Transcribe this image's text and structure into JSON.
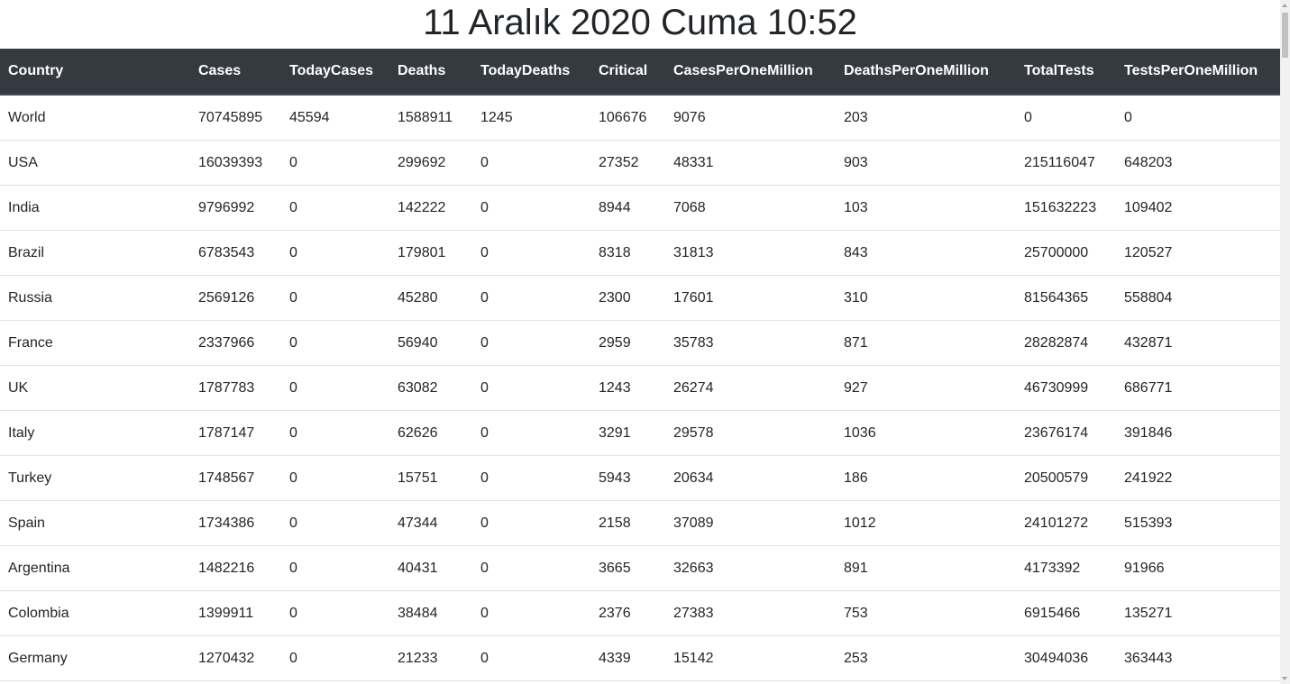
{
  "page": {
    "title": "11 Aralık 2020 Cuma 10:52"
  },
  "table": {
    "headers": [
      "Country",
      "Cases",
      "TodayCases",
      "Deaths",
      "TodayDeaths",
      "Critical",
      "CasesPerOneMillion",
      "DeathsPerOneMillion",
      "TotalTests",
      "TestsPerOneMillion"
    ],
    "rows": [
      [
        "World",
        "70745895",
        "45594",
        "1588911",
        "1245",
        "106676",
        "9076",
        "203",
        "0",
        "0"
      ],
      [
        "USA",
        "16039393",
        "0",
        "299692",
        "0",
        "27352",
        "48331",
        "903",
        "215116047",
        "648203"
      ],
      [
        "India",
        "9796992",
        "0",
        "142222",
        "0",
        "8944",
        "7068",
        "103",
        "151632223",
        "109402"
      ],
      [
        "Brazil",
        "6783543",
        "0",
        "179801",
        "0",
        "8318",
        "31813",
        "843",
        "25700000",
        "120527"
      ],
      [
        "Russia",
        "2569126",
        "0",
        "45280",
        "0",
        "2300",
        "17601",
        "310",
        "81564365",
        "558804"
      ],
      [
        "France",
        "2337966",
        "0",
        "56940",
        "0",
        "2959",
        "35783",
        "871",
        "28282874",
        "432871"
      ],
      [
        "UK",
        "1787783",
        "0",
        "63082",
        "0",
        "1243",
        "26274",
        "927",
        "46730999",
        "686771"
      ],
      [
        "Italy",
        "1787147",
        "0",
        "62626",
        "0",
        "3291",
        "29578",
        "1036",
        "23676174",
        "391846"
      ],
      [
        "Turkey",
        "1748567",
        "0",
        "15751",
        "0",
        "5943",
        "20634",
        "186",
        "20500579",
        "241922"
      ],
      [
        "Spain",
        "1734386",
        "0",
        "47344",
        "0",
        "2158",
        "37089",
        "1012",
        "24101272",
        "515393"
      ],
      [
        "Argentina",
        "1482216",
        "0",
        "40431",
        "0",
        "3665",
        "32663",
        "891",
        "4173392",
        "91966"
      ],
      [
        "Colombia",
        "1399911",
        "0",
        "38484",
        "0",
        "2376",
        "27383",
        "753",
        "6915466",
        "135271"
      ],
      [
        "Germany",
        "1270432",
        "0",
        "21233",
        "0",
        "4339",
        "15142",
        "253",
        "30494036",
        "363443"
      ]
    ]
  },
  "colors": {
    "header_background": "#343a40",
    "header_text": "#ffffff",
    "body_text": "#212529",
    "row_border": "#dee2e6"
  }
}
